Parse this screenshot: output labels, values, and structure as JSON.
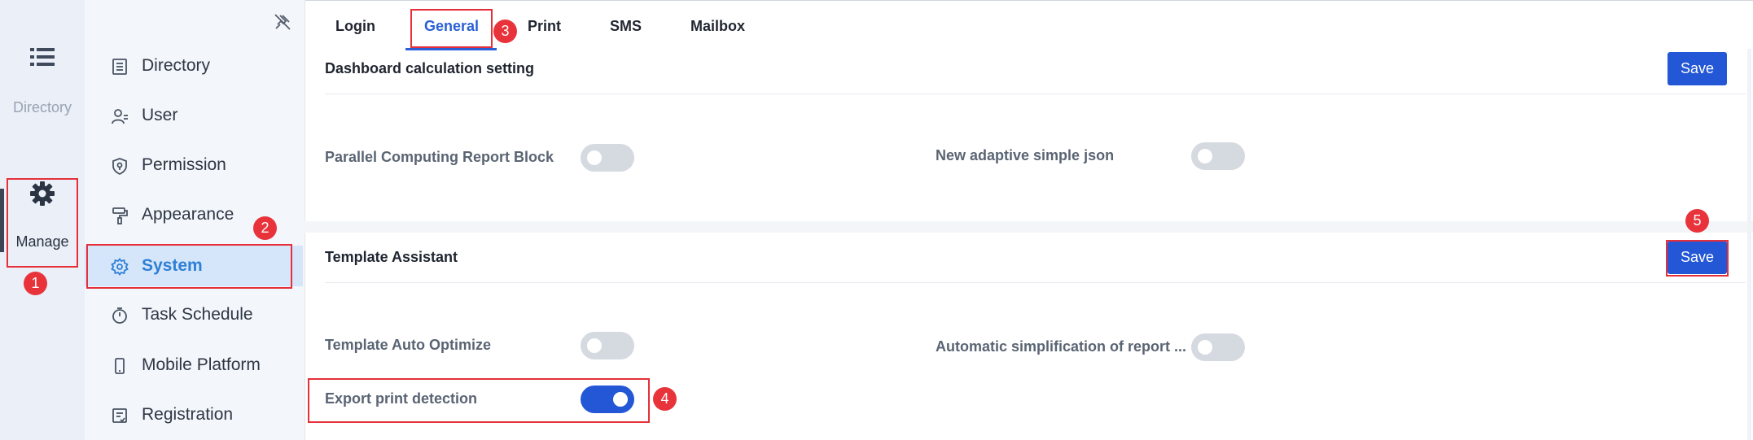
{
  "rail": {
    "directory_label": "Directory",
    "manage_label": "Manage"
  },
  "sidebar": {
    "items": [
      {
        "label": "Directory",
        "icon": "list-document-icon"
      },
      {
        "label": "User",
        "icon": "user-icon"
      },
      {
        "label": "Permission",
        "icon": "shield-icon"
      },
      {
        "label": "Appearance",
        "icon": "paint-roller-icon"
      },
      {
        "label": "System",
        "icon": "gear-icon",
        "active": true
      },
      {
        "label": "Task Schedule",
        "icon": "timer-icon"
      },
      {
        "label": "Mobile Platform",
        "icon": "mobile-icon"
      },
      {
        "label": "Registration",
        "icon": "registration-icon"
      }
    ]
  },
  "tabs": {
    "items": [
      {
        "label": "Login"
      },
      {
        "label": "General",
        "active": true
      },
      {
        "label": "Print"
      },
      {
        "label": "SMS"
      },
      {
        "label": "Mailbox"
      }
    ]
  },
  "sections": [
    {
      "title": "Dashboard calculation setting",
      "save_label": "Save",
      "settings": [
        {
          "label": "Parallel Computing Report Block",
          "on": false
        },
        {
          "label": "New adaptive simple json",
          "on": false
        }
      ]
    },
    {
      "title": "Template Assistant",
      "save_label": "Save",
      "settings": [
        {
          "label": "Template Auto Optimize",
          "on": false
        },
        {
          "label": "Automatic simplification of report ...",
          "on": false
        },
        {
          "label": "Export print detection",
          "on": true
        }
      ]
    }
  ],
  "annotations": [
    "1",
    "2",
    "3",
    "4",
    "5"
  ],
  "colors": {
    "accent": "#2357d6",
    "annotation": "#e5303a",
    "active_sidebar_bg": "#d6e6fa",
    "active_sidebar_text": "#2e7fd6"
  }
}
